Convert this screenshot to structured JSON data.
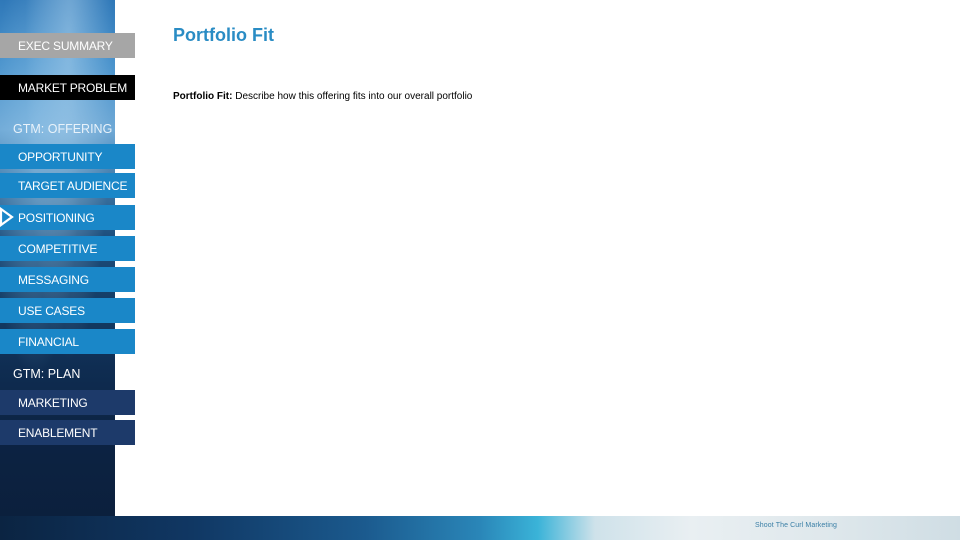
{
  "page": {
    "title": "Portfolio Fit",
    "description_label": "Portfolio Fit:",
    "description_text": " Describe how this offering fits into our overall portfolio"
  },
  "sidebar": {
    "items": [
      {
        "label": "EXEC SUMMARY",
        "style": "gray"
      },
      {
        "label": "MARKET PROBLEM",
        "style": "black"
      }
    ],
    "offering_header": "GTM: OFFERING",
    "offering_items": [
      {
        "label": "OPPORTUNITY"
      },
      {
        "label": "TARGET AUDIENCE"
      },
      {
        "label": "POSITIONING",
        "active": true
      },
      {
        "label": "COMPETITIVE"
      },
      {
        "label": "MESSAGING"
      },
      {
        "label": "USE CASES"
      },
      {
        "label": "FINANCIAL"
      }
    ],
    "plan_header": "GTM: PLAN",
    "plan_items": [
      {
        "label": "MARKETING"
      },
      {
        "label": "ENABLEMENT"
      }
    ]
  },
  "footer": {
    "brand": "Shoot The Curl Marketing"
  },
  "colors": {
    "accent": "#2a8cc4",
    "nav_blue": "#1a87c8",
    "nav_navy": "#1d3a6a",
    "nav_gray": "#a6a6a6",
    "nav_black": "#000000"
  },
  "icons": {
    "active_marker": "triangle-right-outline"
  }
}
